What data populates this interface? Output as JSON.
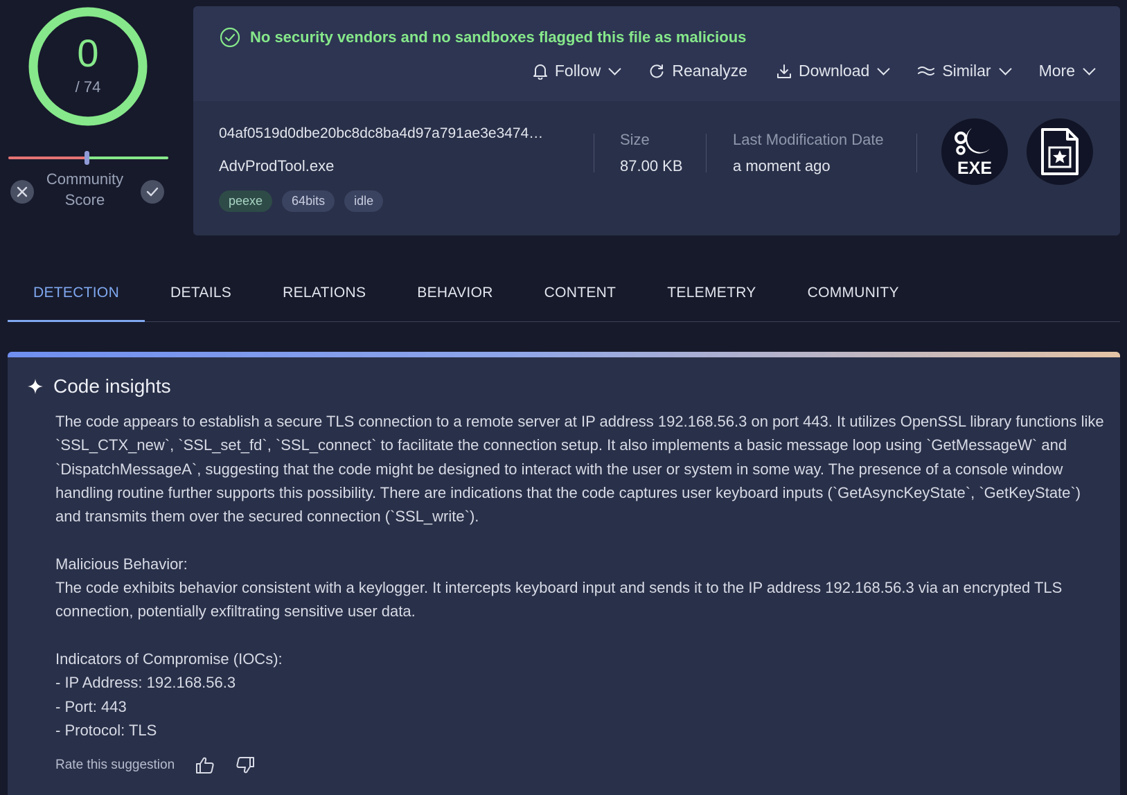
{
  "score": {
    "detections": "0",
    "total": "/ 74",
    "community_label": "Community Score",
    "ring_color": "#86e88a"
  },
  "header": {
    "verdict": "No security vendors and no sandboxes flagged this file as malicious",
    "actions": {
      "follow": "Follow",
      "reanalyze": "Reanalyze",
      "download": "Download",
      "similar": "Similar",
      "more": "More"
    },
    "file": {
      "hash": "04af0519d0dbe20bc8dc8ba4d97a791ae3e3474…",
      "name": "AdvProdTool.exe",
      "tags": [
        "peexe",
        "64bits",
        "idle"
      ]
    },
    "size": {
      "label": "Size",
      "value": "87.00 KB"
    },
    "modified": {
      "label": "Last Modification Date",
      "value": "a moment ago"
    },
    "file_type_label": "EXE"
  },
  "tabs": [
    "DETECTION",
    "DETAILS",
    "RELATIONS",
    "BEHAVIOR",
    "CONTENT",
    "TELEMETRY",
    "COMMUNITY"
  ],
  "active_tab": "DETECTION",
  "insights": {
    "title": "Code insights",
    "body": "The code appears to establish a secure TLS connection to a remote server at IP address 192.168.56.3 on port 443. It utilizes OpenSSL library functions like `SSL_CTX_new`, `SSL_set_fd`, `SSL_connect` to facilitate the connection setup. It also implements a basic message loop using `GetMessageW` and `DispatchMessageA`, suggesting that the code might be designed to interact with the user or system in some way. The presence of a console window handling routine further supports this possibility. There are indications that the code captures user keyboard inputs (`GetAsyncKeyState`, `GetKeyState`) and transmits them over the secured connection (`SSL_write`).\n\nMalicious Behavior:\nThe code exhibits behavior consistent with a keylogger. It intercepts keyboard input and sends it to the IP address 192.168.56.3 via an encrypted TLS connection, potentially exfiltrating sensitive user data.\n\nIndicators of Compromise (IOCs):\n- IP Address: 192.168.56.3\n- Port: 443\n- Protocol: TLS",
    "rate_label": "Rate this suggestion"
  }
}
